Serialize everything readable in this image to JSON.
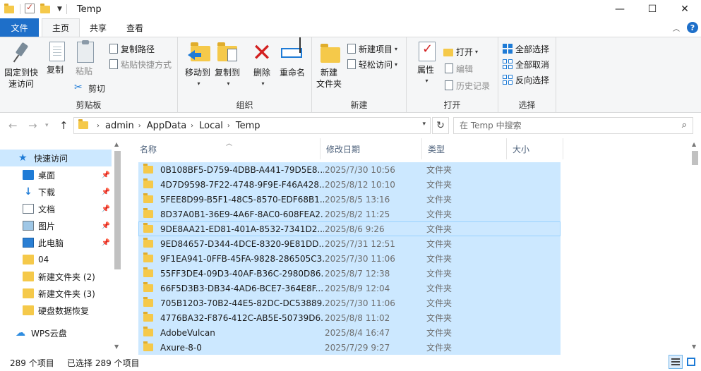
{
  "window": {
    "title": "Temp",
    "controls": {
      "minimize": "—",
      "maximize": "☐",
      "close": "✕"
    }
  },
  "tabs": {
    "file": "文件",
    "home": "主页",
    "share": "共享",
    "view": "查看"
  },
  "ribbon": {
    "clipboard": {
      "label": "剪贴板",
      "pin_quick": "固定到快\n速访问",
      "pin_quick_l1": "固定到快",
      "pin_quick_l2": "速访问",
      "copy": "复制",
      "paste": "粘贴",
      "copy_path": "复制路径",
      "paste_shortcut": "粘贴快捷方式",
      "cut": "剪切"
    },
    "organize": {
      "label": "组织",
      "move_to": "移动到",
      "copy_to": "复制到",
      "delete": "删除",
      "rename": "重命名"
    },
    "new": {
      "label": "新建",
      "new_folder_l1": "新建",
      "new_folder_l2": "文件夹",
      "new_item": "新建项目",
      "easy_access": "轻松访问"
    },
    "open": {
      "label": "打开",
      "properties": "属性",
      "open": "打开",
      "edit": "编辑",
      "history": "历史记录"
    },
    "select": {
      "label": "选择",
      "select_all": "全部选择",
      "select_none": "全部取消",
      "invert": "反向选择"
    }
  },
  "address": {
    "crumbs": [
      "admin",
      "AppData",
      "Local",
      "Temp"
    ],
    "search_placeholder": "在 Temp 中搜索"
  },
  "navpane": {
    "items": [
      {
        "label": "快速访问",
        "icon": "star-icon",
        "pinned": false
      },
      {
        "label": "桌面",
        "icon": "desktop-icon",
        "pinned": true
      },
      {
        "label": "下载",
        "icon": "download-icon",
        "pinned": true
      },
      {
        "label": "文档",
        "icon": "document-icon",
        "pinned": true
      },
      {
        "label": "图片",
        "icon": "picture-icon",
        "pinned": true
      },
      {
        "label": "此电脑",
        "icon": "computer-icon",
        "pinned": true
      },
      {
        "label": "04",
        "icon": "folder-icon",
        "pinned": false
      },
      {
        "label": "新建文件夹 (2)",
        "icon": "folder-icon",
        "pinned": false
      },
      {
        "label": "新建文件夹 (3)",
        "icon": "folder-icon",
        "pinned": false
      },
      {
        "label": "硬盘数据恢复",
        "icon": "folder-icon",
        "pinned": false
      },
      {
        "label": "WPS云盘",
        "icon": "cloud-icon",
        "pinned": false
      }
    ]
  },
  "columns": {
    "name": "名称",
    "modified": "修改日期",
    "type": "类型",
    "size": "大小"
  },
  "files": [
    {
      "name": "0B108BF5-D759-4DBB-A441-79D5E8...",
      "date": "2025/7/30 10:56",
      "type": "文件夹"
    },
    {
      "name": "4D7D9598-7F22-4748-9F9E-F46A428...",
      "date": "2025/8/12 10:10",
      "type": "文件夹"
    },
    {
      "name": "5FEE8D99-B5F1-48C5-8570-EDF68B1...",
      "date": "2025/8/5 13:16",
      "type": "文件夹"
    },
    {
      "name": "8D37A0B1-36E9-4A6F-8AC0-608FEA2...",
      "date": "2025/8/2 11:25",
      "type": "文件夹"
    },
    {
      "name": "9DE8AA21-ED81-401A-8532-7341D2...",
      "date": "2025/8/6 9:26",
      "type": "文件夹"
    },
    {
      "name": "9ED84657-D344-4DCE-8320-9E81DD...",
      "date": "2025/7/31 12:51",
      "type": "文件夹"
    },
    {
      "name": "9F1EA941-0FFB-45FA-9828-286505C3...",
      "date": "2025/7/30 11:06",
      "type": "文件夹"
    },
    {
      "name": "55FF3DE4-09D3-40AF-B36C-2980D86...",
      "date": "2025/8/7 12:38",
      "type": "文件夹"
    },
    {
      "name": "66F5D3B3-DB34-4AD6-BCE7-364E8F...",
      "date": "2025/8/9 12:04",
      "type": "文件夹"
    },
    {
      "name": "705B1203-70B2-44E5-82DC-DC53889...",
      "date": "2025/7/30 11:06",
      "type": "文件夹"
    },
    {
      "name": "4776BA32-F876-412C-AB5E-50739D6...",
      "date": "2025/8/8 11:02",
      "type": "文件夹"
    },
    {
      "name": "AdobeVulcan",
      "date": "2025/8/4 16:47",
      "type": "文件夹"
    },
    {
      "name": "Axure-8-0",
      "date": "2025/7/29 9:27",
      "type": "文件夹"
    }
  ],
  "status": {
    "count": "289 个项目",
    "selected": "已选择 289 个项目"
  },
  "colors": {
    "accent": "#1e6fc9",
    "selection": "#cce8ff",
    "folder": "#f5c94a"
  }
}
